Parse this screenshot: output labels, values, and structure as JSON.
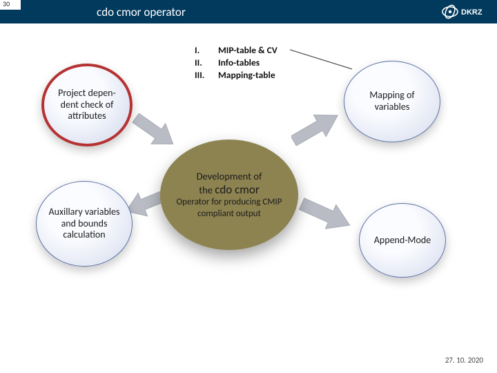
{
  "header": {
    "page_number": "30",
    "title": "cdo cmor operator",
    "logo_text": "DKRZ"
  },
  "center": {
    "line1": "Development of",
    "line2_pre": "the ",
    "line2_emph": "cdo cmor",
    "line3": "Operator for producing CMIP compliant output"
  },
  "satellites": {
    "top_left": "Project depen-\ndent check of attributes",
    "bottom_left": "Auxillary variables and bounds calculation",
    "top_right": "Mapping of variables",
    "bottom_right": "Append-Mode"
  },
  "list": [
    {
      "num": "I.",
      "label": "MIP-table & CV"
    },
    {
      "num": "II.",
      "label": "Info-tables"
    },
    {
      "num": "III.",
      "label": "Mapping-table"
    }
  ],
  "footer": {
    "date": "27. 10. 2020"
  },
  "colors": {
    "header_bg": "#013a5d",
    "center_fill": "#8d8351",
    "highlight_border": "#b53232",
    "arrow_fill": "#b9bcc4"
  }
}
